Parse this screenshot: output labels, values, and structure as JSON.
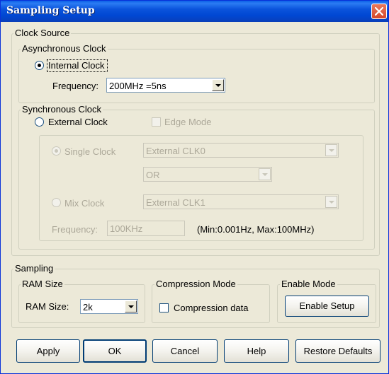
{
  "window": {
    "title": "Sampling Setup"
  },
  "clock_source": {
    "label": "Clock Source",
    "async": {
      "label": "Asynchronous Clock",
      "internal_clock_label": "Internal Clock",
      "internal_clock_selected": true,
      "frequency_label": "Frequency:",
      "frequency_value": "200MHz =5ns"
    },
    "sync": {
      "label": "Synchronous Clock",
      "external_clock_label": "External Clock",
      "external_clock_selected": false,
      "edge_mode_label": "Edge Mode",
      "edge_mode_checked": false,
      "single_clock_label": "Single Clock",
      "single_clock_selected": true,
      "single_clock_value": "External CLK0",
      "logic_value": "OR",
      "mix_clock_label": "Mix Clock",
      "mix_clock_selected": false,
      "mix_clock_value": "External CLK1",
      "frequency_label": "Frequency:",
      "frequency_value": "100KHz",
      "frequency_range": "(Min:0.001Hz, Max:100MHz)"
    }
  },
  "sampling": {
    "label": "Sampling",
    "ram": {
      "label": "RAM Size",
      "field_label": "RAM Size:",
      "value": "2k"
    },
    "compression": {
      "label": "Compression Mode",
      "checkbox_label": "Compression data",
      "checked": false
    },
    "enable": {
      "label": "Enable Mode",
      "button_label": "Enable Setup"
    }
  },
  "buttons": {
    "apply": "Apply",
    "ok": "OK",
    "cancel": "Cancel",
    "help": "Help",
    "restore": "Restore Defaults"
  },
  "colors": {
    "titlebar": "#0054e3",
    "dialog_bg": "#ece9d8",
    "close": "#d6482a"
  }
}
